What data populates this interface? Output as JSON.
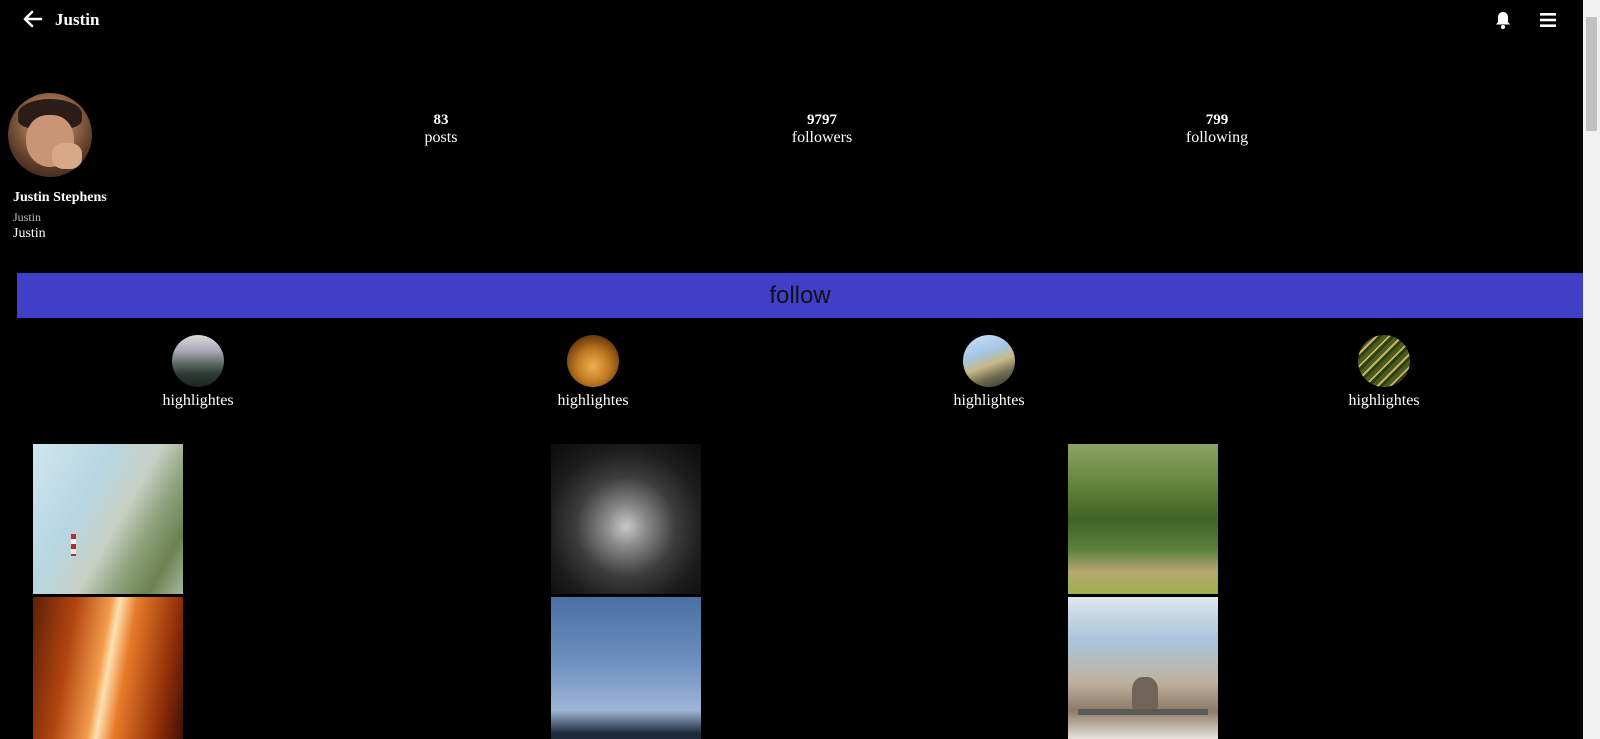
{
  "header": {
    "title": "Justin",
    "back_icon": "arrow-left-icon",
    "bell_icon": "bell-icon",
    "menu_icon": "hamburger-menu-icon"
  },
  "profile": {
    "name": "Justin Stephens",
    "username": "Justin",
    "bio": "Justin"
  },
  "stats": {
    "posts": {
      "count": "83",
      "label": "posts"
    },
    "followers": {
      "count": "9797",
      "label": "followers"
    },
    "following": {
      "count": "799",
      "label": "following"
    }
  },
  "follow_button": {
    "label": "follow",
    "color": "#3f3fc8"
  },
  "highlights": [
    {
      "label": "highlightes"
    },
    {
      "label": "highlightes"
    },
    {
      "label": "highlightes"
    },
    {
      "label": "highlightes"
    }
  ],
  "colors": {
    "background": "#000000",
    "text": "#ffffff",
    "accent": "#3f3fc8"
  }
}
